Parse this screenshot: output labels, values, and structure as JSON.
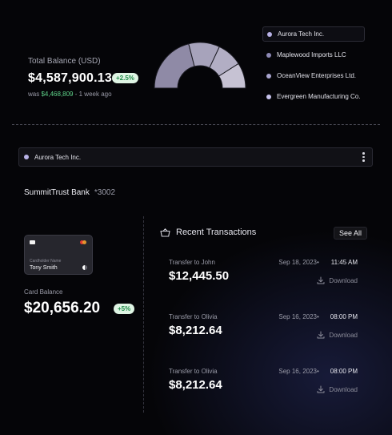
{
  "summary": {
    "label": "Total Balance (USD)",
    "value": "$4,587,900.13",
    "change": "+2.5%",
    "was_prefix": "was",
    "was_value": "$4,468,809",
    "was_suffix": "- 1 week ago"
  },
  "gauge": {
    "colors": [
      "#8f8aa6",
      "#a7a3bb",
      "#b2aec4",
      "#c6c2d3"
    ],
    "shares": [
      0.42,
      0.22,
      0.18,
      0.18
    ]
  },
  "legend": [
    {
      "label": "Aurora Tech Inc.",
      "color": "#b8b2e6",
      "active": true
    },
    {
      "label": "Maplewood Imports LLC",
      "color": "#8d89b5",
      "active": false
    },
    {
      "label": "OceanView Enterprises Ltd.",
      "color": "#a9a5cf",
      "active": false
    },
    {
      "label": "Evergreen Manufacturing Co.",
      "color": "#c7c3ec",
      "active": false
    }
  ],
  "account_selector": {
    "label": "Aurora Tech Inc.",
    "dot_color": "#b8b2e6"
  },
  "bank": {
    "name": "SummitTrust Bank",
    "account": "*3002"
  },
  "card": {
    "holder_label": "Cardholder Name",
    "holder": "Tony Smith",
    "balance_label": "Card Balance",
    "balance": "$20,656.20",
    "change": "+5%"
  },
  "transactions": {
    "title": "Recent Transactions",
    "see_all": "See All",
    "items": [
      {
        "name": "Transfer to John",
        "amount": "$12,445.50",
        "date": "Sep 18, 2023",
        "bullet": "•",
        "time": "11:45 AM",
        "action": "Download"
      },
      {
        "name": "Transfer to Olivia",
        "amount": "$8,212.64",
        "date": "Sep 16, 2023",
        "bullet": "•",
        "time": "08:00 PM",
        "action": "Download"
      },
      {
        "name": "Transfer to Olivia",
        "amount": "$8,212.64",
        "date": "Sep 16, 2023",
        "bullet": "•",
        "time": "08:00 PM",
        "action": "Download"
      }
    ]
  }
}
